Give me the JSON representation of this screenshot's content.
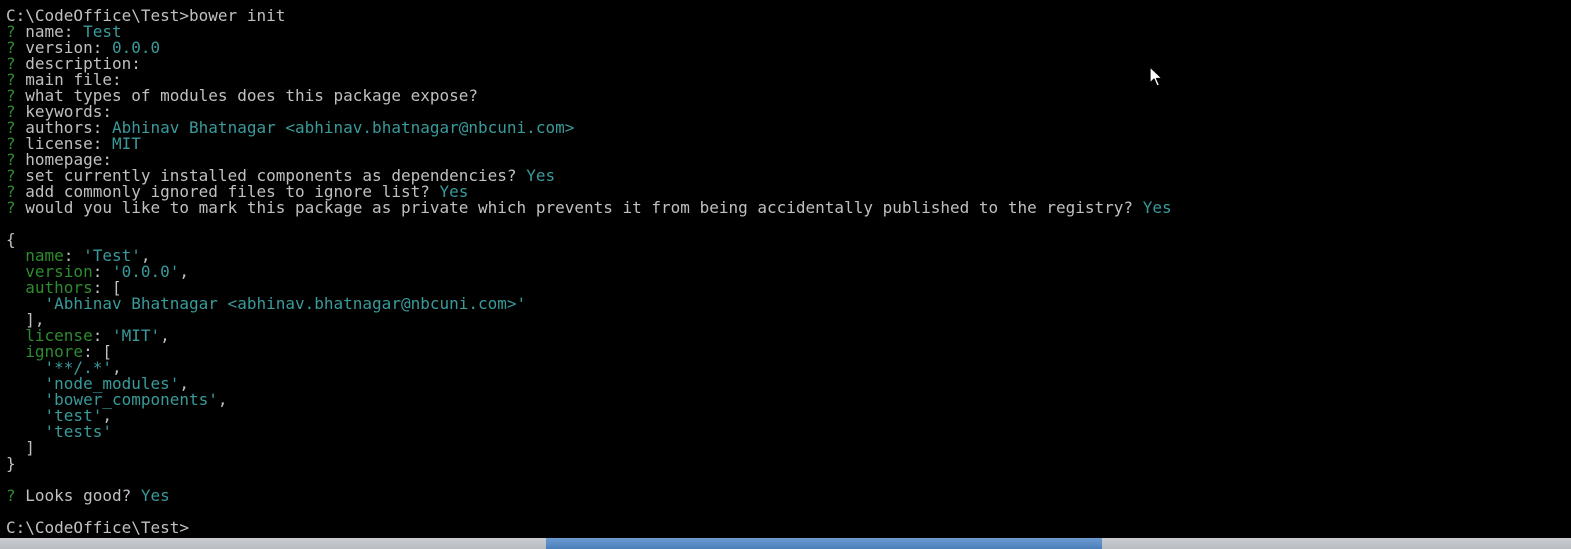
{
  "terminal": {
    "lines": [
      {
        "parts": [
          {
            "t": "C:\\CodeOffice\\Test>bower init",
            "c": "plain"
          }
        ]
      },
      {
        "parts": [
          {
            "t": "?",
            "c": "q"
          },
          {
            "t": " name: ",
            "c": "plain"
          },
          {
            "t": "Test",
            "c": "ans"
          }
        ]
      },
      {
        "parts": [
          {
            "t": "?",
            "c": "q"
          },
          {
            "t": " version: ",
            "c": "plain"
          },
          {
            "t": "0.0.0",
            "c": "ans"
          }
        ]
      },
      {
        "parts": [
          {
            "t": "?",
            "c": "q"
          },
          {
            "t": " description:",
            "c": "plain"
          }
        ]
      },
      {
        "parts": [
          {
            "t": "?",
            "c": "q"
          },
          {
            "t": " main file:",
            "c": "plain"
          }
        ]
      },
      {
        "parts": [
          {
            "t": "?",
            "c": "q"
          },
          {
            "t": " what types of modules does this package expose?",
            "c": "plain"
          }
        ]
      },
      {
        "parts": [
          {
            "t": "?",
            "c": "q"
          },
          {
            "t": " keywords:",
            "c": "plain"
          }
        ]
      },
      {
        "parts": [
          {
            "t": "?",
            "c": "q"
          },
          {
            "t": " authors: ",
            "c": "plain"
          },
          {
            "t": "Abhinav Bhatnagar <abhinav.bhatnagar@nbcuni.com>",
            "c": "ans"
          }
        ]
      },
      {
        "parts": [
          {
            "t": "?",
            "c": "q"
          },
          {
            "t": " license: ",
            "c": "plain"
          },
          {
            "t": "MIT",
            "c": "ans"
          }
        ]
      },
      {
        "parts": [
          {
            "t": "?",
            "c": "q"
          },
          {
            "t": " homepage:",
            "c": "plain"
          }
        ]
      },
      {
        "parts": [
          {
            "t": "?",
            "c": "q"
          },
          {
            "t": " set currently installed components as dependencies? ",
            "c": "plain"
          },
          {
            "t": "Yes",
            "c": "ans"
          }
        ]
      },
      {
        "parts": [
          {
            "t": "?",
            "c": "q"
          },
          {
            "t": " add commonly ignored files to ignore list? ",
            "c": "plain"
          },
          {
            "t": "Yes",
            "c": "ans"
          }
        ]
      },
      {
        "parts": [
          {
            "t": "?",
            "c": "q"
          },
          {
            "t": " would you like to mark this package as private which prevents it from being accidentally published to the registry? ",
            "c": "plain"
          },
          {
            "t": "Yes",
            "c": "ans"
          }
        ]
      },
      {
        "parts": [
          {
            "t": "",
            "c": "plain"
          }
        ]
      },
      {
        "parts": [
          {
            "t": "{",
            "c": "plain"
          }
        ]
      },
      {
        "parts": [
          {
            "t": "  ",
            "c": "plain"
          },
          {
            "t": "name",
            "c": "key"
          },
          {
            "t": ": ",
            "c": "plain"
          },
          {
            "t": "'Test'",
            "c": "str"
          },
          {
            "t": ",",
            "c": "plain"
          }
        ]
      },
      {
        "parts": [
          {
            "t": "  ",
            "c": "plain"
          },
          {
            "t": "version",
            "c": "key"
          },
          {
            "t": ": ",
            "c": "plain"
          },
          {
            "t": "'0.0.0'",
            "c": "str"
          },
          {
            "t": ",",
            "c": "plain"
          }
        ]
      },
      {
        "parts": [
          {
            "t": "  ",
            "c": "plain"
          },
          {
            "t": "authors",
            "c": "key"
          },
          {
            "t": ": [",
            "c": "plain"
          }
        ]
      },
      {
        "parts": [
          {
            "t": "    ",
            "c": "plain"
          },
          {
            "t": "'Abhinav Bhatnagar <abhinav.bhatnagar@nbcuni.com>'",
            "c": "str"
          }
        ]
      },
      {
        "parts": [
          {
            "t": "  ],",
            "c": "plain"
          }
        ]
      },
      {
        "parts": [
          {
            "t": "  ",
            "c": "plain"
          },
          {
            "t": "license",
            "c": "key"
          },
          {
            "t": ": ",
            "c": "plain"
          },
          {
            "t": "'MIT'",
            "c": "str"
          },
          {
            "t": ",",
            "c": "plain"
          }
        ]
      },
      {
        "parts": [
          {
            "t": "  ",
            "c": "plain"
          },
          {
            "t": "ignore",
            "c": "key"
          },
          {
            "t": ": [",
            "c": "plain"
          }
        ]
      },
      {
        "parts": [
          {
            "t": "    ",
            "c": "plain"
          },
          {
            "t": "'**/.*'",
            "c": "str"
          },
          {
            "t": ",",
            "c": "plain"
          }
        ]
      },
      {
        "parts": [
          {
            "t": "    ",
            "c": "plain"
          },
          {
            "t": "'node_modules'",
            "c": "str"
          },
          {
            "t": ",",
            "c": "plain"
          }
        ]
      },
      {
        "parts": [
          {
            "t": "    ",
            "c": "plain"
          },
          {
            "t": "'bower_components'",
            "c": "str"
          },
          {
            "t": ",",
            "c": "plain"
          }
        ]
      },
      {
        "parts": [
          {
            "t": "    ",
            "c": "plain"
          },
          {
            "t": "'test'",
            "c": "str"
          },
          {
            "t": ",",
            "c": "plain"
          }
        ]
      },
      {
        "parts": [
          {
            "t": "    ",
            "c": "plain"
          },
          {
            "t": "'tests'",
            "c": "str"
          }
        ]
      },
      {
        "parts": [
          {
            "t": "  ]",
            "c": "plain"
          }
        ]
      },
      {
        "parts": [
          {
            "t": "}",
            "c": "plain"
          }
        ]
      },
      {
        "parts": [
          {
            "t": "",
            "c": "plain"
          }
        ]
      },
      {
        "parts": [
          {
            "t": "?",
            "c": "q"
          },
          {
            "t": " Looks good? ",
            "c": "plain"
          },
          {
            "t": "Yes",
            "c": "ans"
          }
        ]
      },
      {
        "parts": [
          {
            "t": "",
            "c": "plain"
          }
        ]
      },
      {
        "parts": [
          {
            "t": "C:\\CodeOffice\\Test>",
            "c": "plain"
          }
        ]
      }
    ]
  },
  "colors": {
    "background": "#000000",
    "text": "#c0c0c0",
    "prompt_marker": "#2e8b2e",
    "answer": "#3a9a9a"
  },
  "icons": {
    "cursor": "mouse-pointer-icon"
  }
}
